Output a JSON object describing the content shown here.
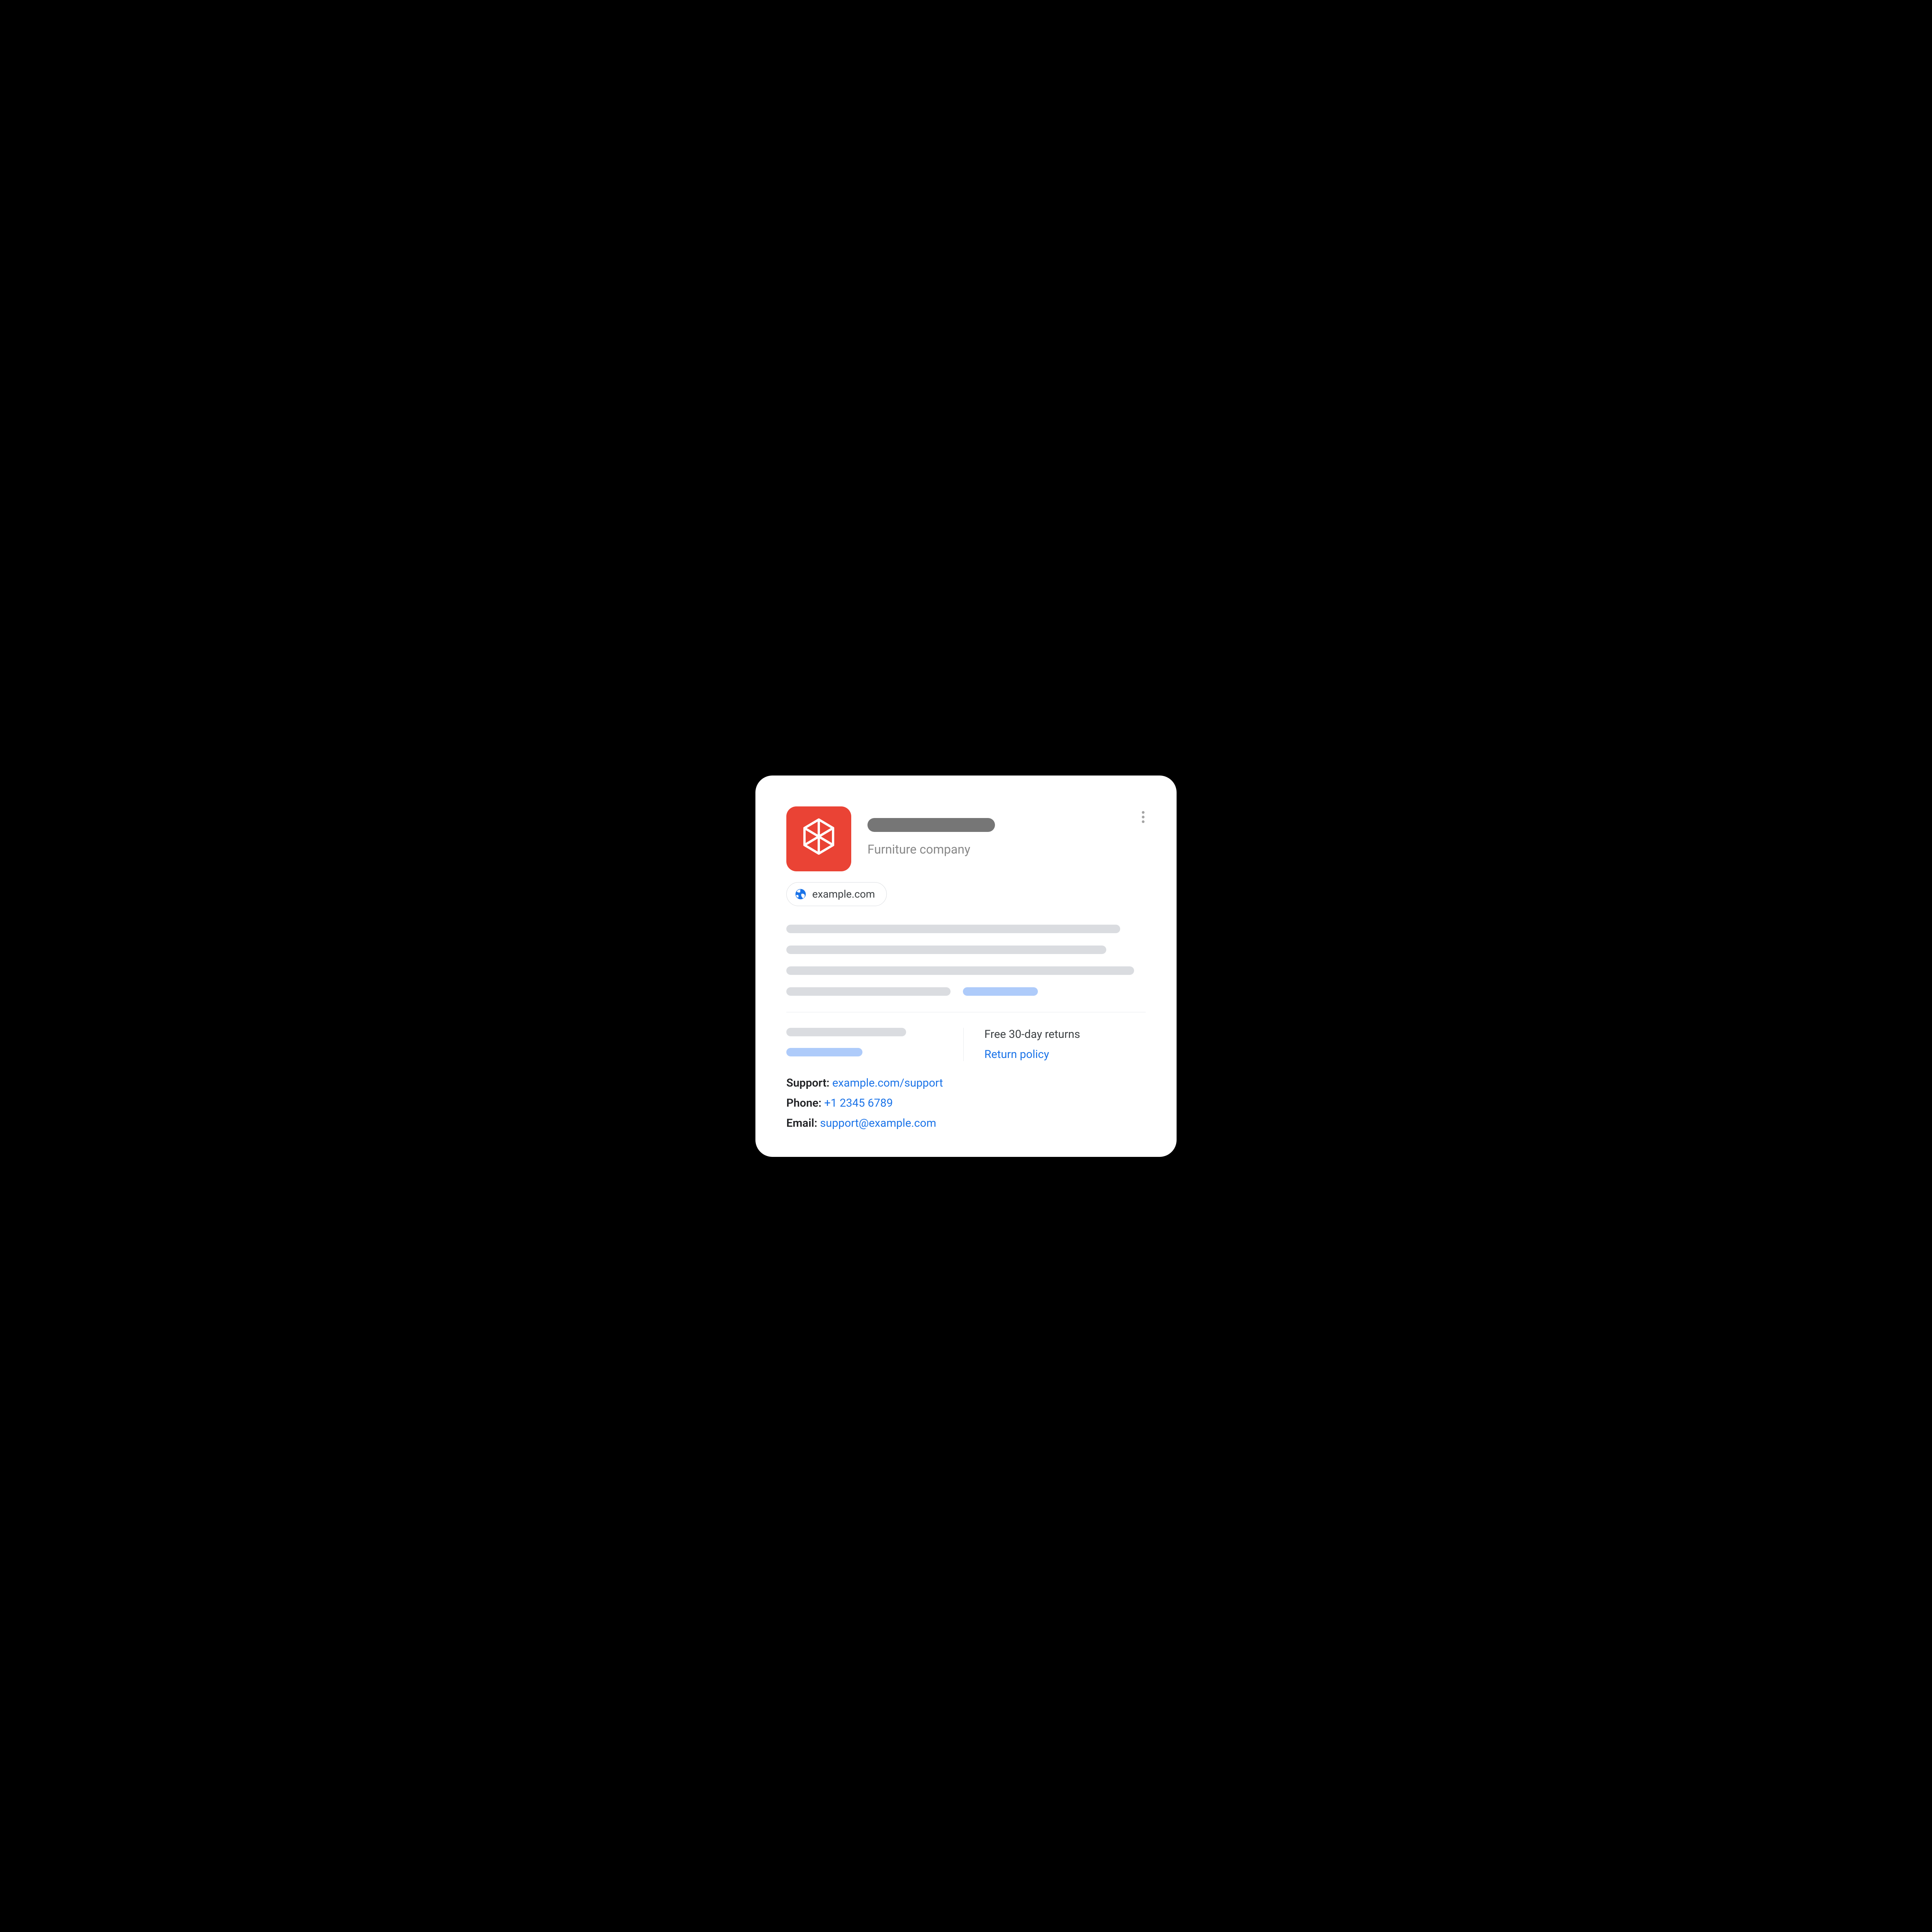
{
  "header": {
    "subtitle": "Furniture company"
  },
  "website_chip": {
    "domain": "example.com"
  },
  "info": {
    "returns_title": "Free 30-day returns",
    "returns_link": "Return policy"
  },
  "contact": {
    "support_label": "Support:",
    "support_value": "example.com/support",
    "phone_label": "Phone:",
    "phone_value": "+1 2345 6789",
    "email_label": "Email:",
    "email_value": "support@example.com"
  },
  "colors": {
    "logo_bg": "#ea4335",
    "link": "#1a73e8",
    "placeholder_gray": "#dadce0",
    "placeholder_darkgray": "#767676",
    "placeholder_blue": "#aecbfa"
  }
}
